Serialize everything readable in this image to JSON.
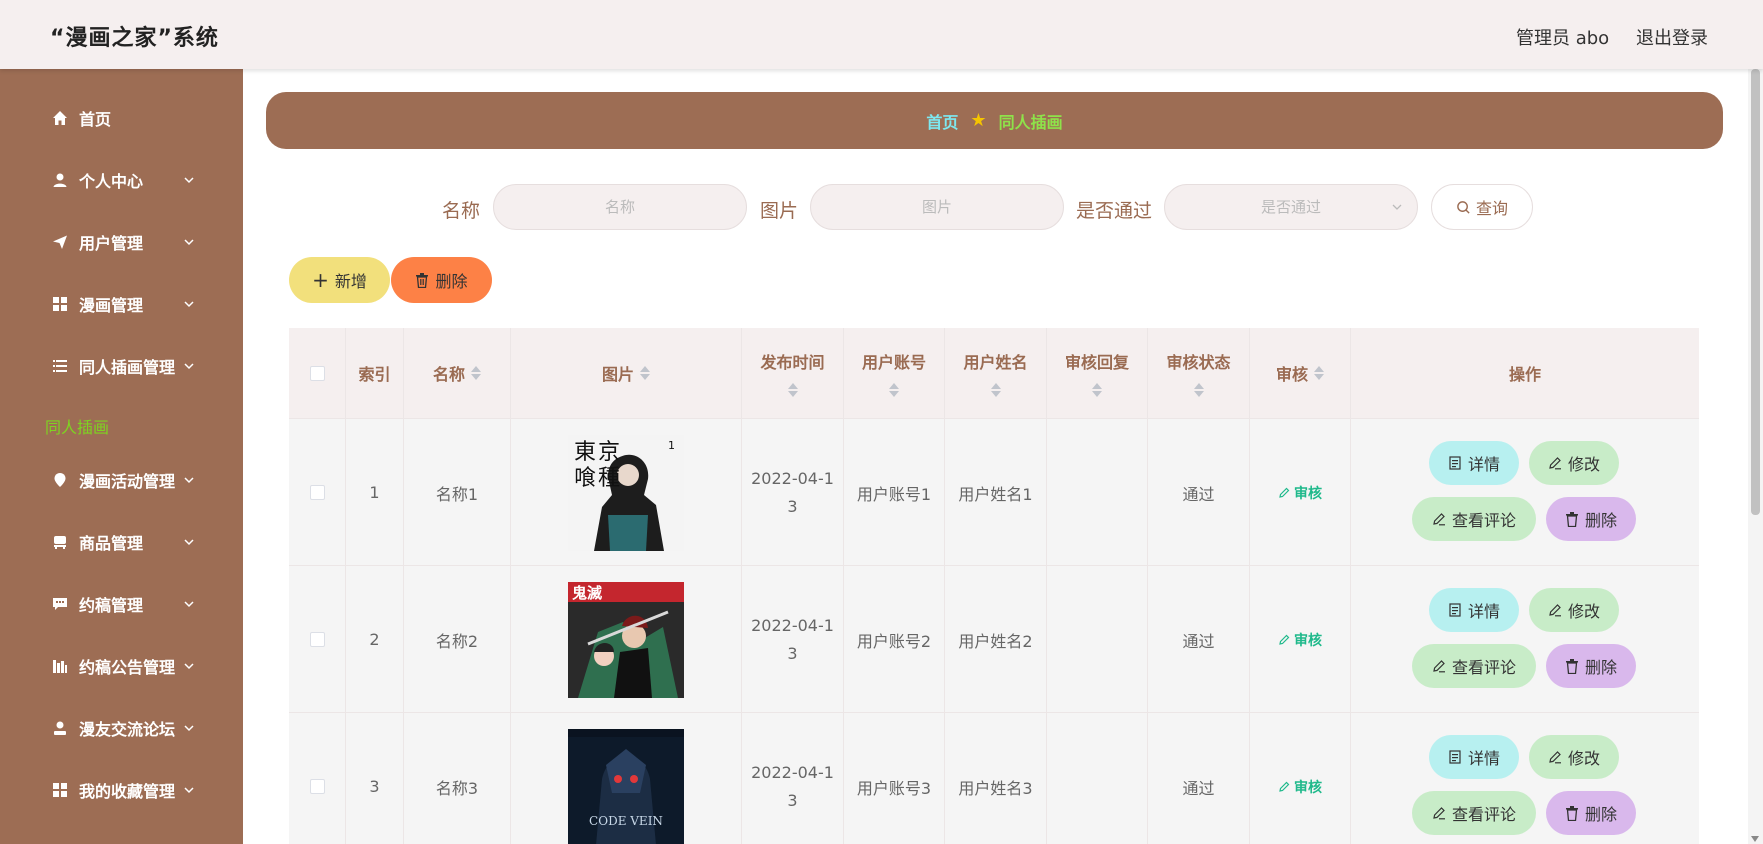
{
  "header": {
    "brand": "“漫画之家”系统",
    "user": "管理员 abo",
    "logout": "退出登录"
  },
  "sidebar": {
    "items": [
      {
        "label": "首页",
        "icon": "home-icon",
        "has_children": false
      },
      {
        "label": "个人中心",
        "icon": "user-icon",
        "has_children": true
      },
      {
        "label": "用户管理",
        "icon": "send-icon",
        "has_children": true
      },
      {
        "label": "漫画管理",
        "icon": "grid-icon",
        "has_children": true
      },
      {
        "label": "同人插画管理",
        "icon": "list-icon",
        "has_children": true
      },
      {
        "label": "漫画活动管理",
        "icon": "location-icon",
        "has_children": true
      },
      {
        "label": "商品管理",
        "icon": "chair-icon",
        "has_children": true
      },
      {
        "label": "约稿管理",
        "icon": "chat-icon",
        "has_children": true
      },
      {
        "label": "约稿公告管理",
        "icon": "chart-icon",
        "has_children": true
      },
      {
        "label": "漫友交流论坛",
        "icon": "person-icon",
        "has_children": true
      },
      {
        "label": "我的收藏管理",
        "icon": "grid-icon",
        "has_children": true
      }
    ],
    "active_submenu": "同人插画"
  },
  "breadcrumb": {
    "home": "首页",
    "current": "同人插画"
  },
  "search": {
    "name_label": "名称",
    "name_placeholder": "名称",
    "image_label": "图片",
    "image_placeholder": "图片",
    "pass_label": "是否通过",
    "pass_placeholder": "是否通过",
    "query_button": "查询"
  },
  "toolbar": {
    "add": "新增",
    "delete": "删除"
  },
  "table": {
    "headers": {
      "index": "索引",
      "name": "名称",
      "image": "图片",
      "publish_time": "发布时间",
      "user_account": "用户账号",
      "user_name": "用户姓名",
      "audit_reply": "审核回复",
      "audit_status": "审核状态",
      "audit": "审核",
      "actions": "操作"
    },
    "rows": [
      {
        "index": "1",
        "name": "名称1",
        "time": "2022-04-13",
        "account": "用户账号1",
        "username": "用户姓名1",
        "reply": "",
        "status": "通过",
        "audit": "审核"
      },
      {
        "index": "2",
        "name": "名称2",
        "time": "2022-04-13",
        "account": "用户账号2",
        "username": "用户姓名2",
        "reply": "",
        "status": "通过",
        "audit": "审核"
      },
      {
        "index": "3",
        "name": "名称3",
        "time": "2022-04-13",
        "account": "用户账号3",
        "username": "用户姓名3",
        "reply": "",
        "status": "通过",
        "audit": "审核"
      }
    ],
    "row_actions": {
      "detail": "详情",
      "edit": "修改",
      "comments": "查看评论",
      "delete": "删除"
    }
  },
  "colors": {
    "sidebar_bg": "#9d6d54",
    "header_bg": "#f5efef",
    "add_button": "#f2e07c",
    "delete_button": "#fd8146",
    "audit_link": "#1fb98b"
  }
}
